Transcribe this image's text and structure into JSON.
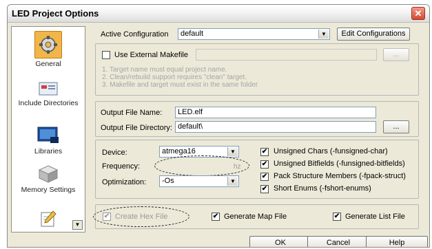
{
  "window": {
    "title": "LED Project Options",
    "close_glyph": "✕"
  },
  "sidebar": {
    "items": [
      {
        "label": "General",
        "icon": "gears-icon",
        "selected": true
      },
      {
        "label": "Include Directories",
        "icon": "folder-icon"
      },
      {
        "label": "Libraries",
        "icon": "books-icon"
      },
      {
        "label": "Memory Settings",
        "icon": "cubes-icon"
      },
      {
        "label": "",
        "icon": "pencil-notepad-icon"
      }
    ],
    "scroll_glyph": "▼"
  },
  "config": {
    "label": "Active Configuration",
    "value": "default",
    "edit_button": "Edit Configurations"
  },
  "makefile": {
    "checkbox_label": "Use External Makefile",
    "checked": false,
    "browse": "...",
    "notes": [
      "1. Target name must equal project name.",
      "2. Clean/rebuild support requires \"clean\" target.",
      "3. Makefile and target must exist in the same folder"
    ]
  },
  "output": {
    "file_name_label": "Output File Name:",
    "file_name_value": "LED.elf",
    "dir_label": "Output File Directory:",
    "dir_value": "default\\",
    "browse": "..."
  },
  "device": {
    "device_label": "Device:",
    "device_value": "atmega16",
    "frequency_label": "Frequency:",
    "frequency_value": "",
    "frequency_unit": "hz",
    "optimization_label": "Optimization:",
    "optimization_value": "-Os"
  },
  "compiler_options": [
    {
      "label": "Unsigned Chars (-funsigned-char)",
      "checked": true
    },
    {
      "label": "Unsigned Bitfields (-funsigned-bitfields)",
      "checked": true
    },
    {
      "label": "Pack Structure Members (-fpack-struct)",
      "checked": true
    },
    {
      "label": "Short Enums (-fshort-enums)",
      "checked": true
    }
  ],
  "output_options": {
    "create_hex": "Create Hex File",
    "map_file": "Generate Map File",
    "list_file": "Generate List File",
    "check_glyph": "✔"
  },
  "footer": {
    "ok": "OK",
    "cancel": "Cancel",
    "help": "Help"
  },
  "colors": {
    "accent": "#f0b64a",
    "dialog_bg": "#ece9d8",
    "close": "#d24a33"
  }
}
